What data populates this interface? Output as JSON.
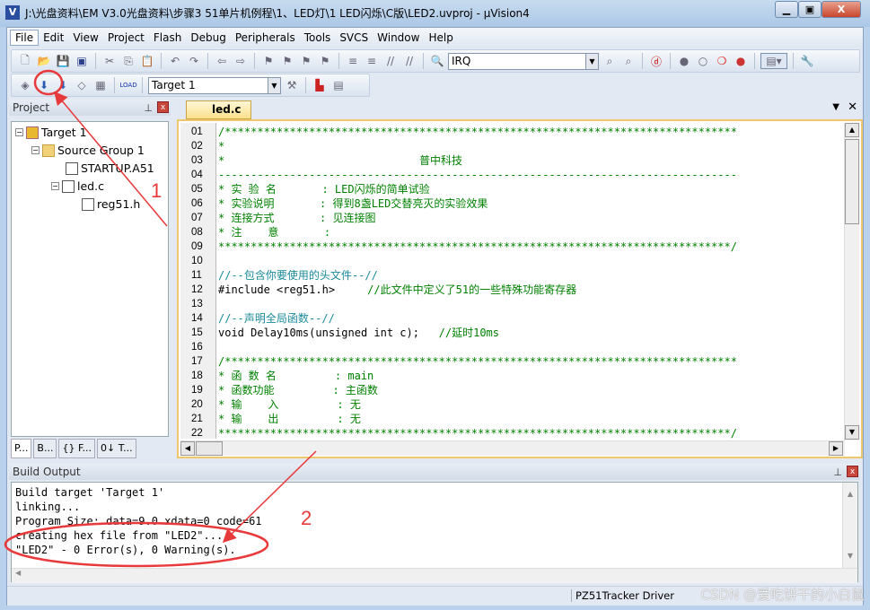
{
  "window": {
    "title": "J:\\光盘资料\\EM V3.0光盘资料\\步骤3 51单片机例程\\1、LED灯\\1 LED闪烁\\C版\\LED2.uvproj - µVision4",
    "icon": "V"
  },
  "menu": [
    "File",
    "Edit",
    "View",
    "Project",
    "Flash",
    "Debug",
    "Peripherals",
    "Tools",
    "SVCS",
    "Window",
    "Help"
  ],
  "toolbar1": {
    "find_combo": "IRQ"
  },
  "toolbar2": {
    "target_combo": "Target 1",
    "load_label": "LOAD"
  },
  "project": {
    "title": "Project",
    "tree": [
      "Target 1",
      "Source Group 1",
      "STARTUP.A51",
      "led.c",
      "reg51.h"
    ],
    "tabs": [
      "P...",
      "B...",
      "{} F...",
      "0↓ T..."
    ]
  },
  "editor": {
    "tab": "led.c",
    "lines": [
      {
        "n": "01",
        "c": "g",
        "t": "/*******************************************************************************"
      },
      {
        "n": "02",
        "c": "g",
        "t": "*"
      },
      {
        "n": "03",
        "c": "g",
        "t": "*                              普中科技"
      },
      {
        "n": "04",
        "c": "g",
        "t": "--------------------------------------------------------------------------------"
      },
      {
        "n": "05",
        "c": "g",
        "t": "* 实 验 名       : LED闪烁的简单试验"
      },
      {
        "n": "06",
        "c": "g",
        "t": "* 实验说明       : 得到8盏LED交替亮灭的实验效果"
      },
      {
        "n": "07",
        "c": "g",
        "t": "* 连接方式       : 见连接图"
      },
      {
        "n": "08",
        "c": "g",
        "t": "* 注    意       :"
      },
      {
        "n": "09",
        "c": "g",
        "t": "*******************************************************************************/"
      },
      {
        "n": "10",
        "c": "b",
        "t": ""
      },
      {
        "n": "11",
        "c": "t",
        "t": "//--包含你要使用的头文件--//"
      },
      {
        "n": "12",
        "c": "b",
        "t": "#include <reg51.h>",
        "cm": "     //此文件中定义了51的一些特殊功能寄存器"
      },
      {
        "n": "13",
        "c": "b",
        "t": ""
      },
      {
        "n": "14",
        "c": "t",
        "t": "//--声明全局函数--//"
      },
      {
        "n": "15",
        "c": "b",
        "t": "void Delay10ms(unsigned int c);",
        "cm": "   //延时10ms"
      },
      {
        "n": "16",
        "c": "b",
        "t": ""
      },
      {
        "n": "17",
        "c": "g",
        "t": "/*******************************************************************************"
      },
      {
        "n": "18",
        "c": "g",
        "t": "* 函 数 名         : main"
      },
      {
        "n": "19",
        "c": "g",
        "t": "* 函数功能         : 主函数"
      },
      {
        "n": "20",
        "c": "g",
        "t": "* 输    入         : 无"
      },
      {
        "n": "21",
        "c": "g",
        "t": "* 输    出         : 无"
      },
      {
        "n": "22",
        "c": "g",
        "t": "*******************************************************************************/"
      }
    ]
  },
  "build_output": {
    "title": "Build Output",
    "lines": [
      "Build target 'Target 1'",
      "linking...",
      "Program Size: data=9.0 xdata=0 code=61",
      "creating hex file from \"LED2\"...",
      "\"LED2\" - 0 Error(s), 0 Warning(s)."
    ]
  },
  "status": {
    "driver": "PZ51Tracker Driver"
  },
  "annotations": {
    "label1": "1",
    "label2": "2",
    "color": "#e8393b"
  },
  "watermark": "CSDN @爱吃饼干的小白鼠"
}
